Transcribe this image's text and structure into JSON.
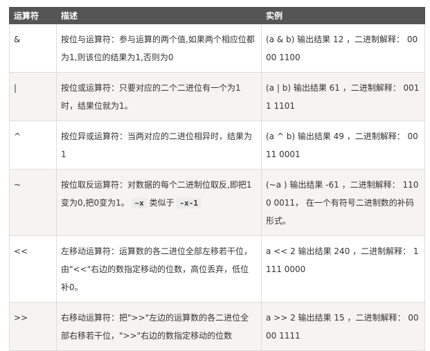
{
  "headers": [
    "运算符",
    "描述",
    "实例"
  ],
  "rows": [
    {
      "op": "&",
      "desc": "按位与运算符：参与运算的两个值,如果两个相应位都为1,则该位的结果为1,否则为0",
      "example": "(a & b) 输出结果 12 ，二进制解释： 0000 1100"
    },
    {
      "op": "|",
      "desc": "按位或运算符：只要对应的二个二进位有一个为1时，结果位就为1。",
      "example": "(a | b) 输出结果 61 ，二进制解释： 0011 1101"
    },
    {
      "op": "^",
      "desc": "按位异或运算符：当两对应的二进位相异时，结果为1",
      "example": "(a ^ b) 输出结果 49 ，二进制解释： 0011 0001"
    },
    {
      "op": "~",
      "desc_pre": "按位取反运算符：对数据的每个二进制位取反,即把1变为0,把0变为1。",
      "desc_code1": "~x",
      "desc_mid": "类似于",
      "desc_code2": "-x-1",
      "example": "(~a ) 输出结果 -61 ，二进制解释： 1100 0011， 在一个有符号二进制数的补码形式。"
    },
    {
      "op": "<<",
      "desc": "左移动运算符：运算数的各二进位全部左移若干位，由\"<<\"右边的数指定移动的位数，高位丢弃，低位补0。",
      "example": "a << 2 输出结果 240 ，二进制解释： 1111 0000"
    },
    {
      "op": ">>",
      "desc": "右移动运算符：把\">>\"左边的运算数的各二进位全部右移若干位，\">>\"右边的数指定移动的位数",
      "example": "a >> 2 输出结果 15 ，二进制解释： 0000 1111"
    }
  ]
}
